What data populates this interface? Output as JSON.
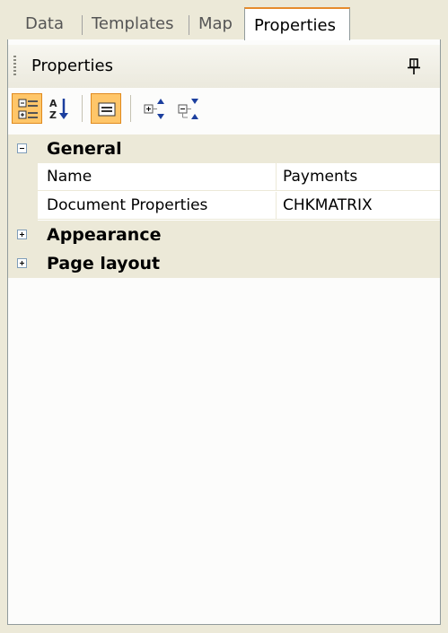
{
  "tabs": [
    {
      "label": "Data",
      "active": false
    },
    {
      "label": "Templates",
      "active": false
    },
    {
      "label": "Map",
      "active": false
    },
    {
      "label": "Properties",
      "active": true
    }
  ],
  "panel": {
    "title": "Properties",
    "pin_icon": "pin-icon"
  },
  "toolbar": {
    "buttons": [
      {
        "icon": "categorized-view-icon",
        "pressed": true
      },
      {
        "icon": "alphabetical-sort-icon",
        "pressed": false
      },
      {
        "icon": "property-pages-icon",
        "pressed": true
      },
      {
        "icon": "expand-all-icon",
        "pressed": false
      },
      {
        "icon": "collapse-all-icon",
        "pressed": false
      }
    ]
  },
  "grid": {
    "categories": [
      {
        "label": "General",
        "expanded": true,
        "properties": [
          {
            "name": "Name",
            "value": "Payments"
          },
          {
            "name": "Document Properties",
            "value": "CHKMATRIX"
          }
        ]
      },
      {
        "label": "Appearance",
        "expanded": false
      },
      {
        "label": "Page layout",
        "expanded": false
      }
    ]
  },
  "colors": {
    "accent": "#e68b2c",
    "button_pressed": "#ffc669",
    "chrome": "#ece9d8"
  }
}
